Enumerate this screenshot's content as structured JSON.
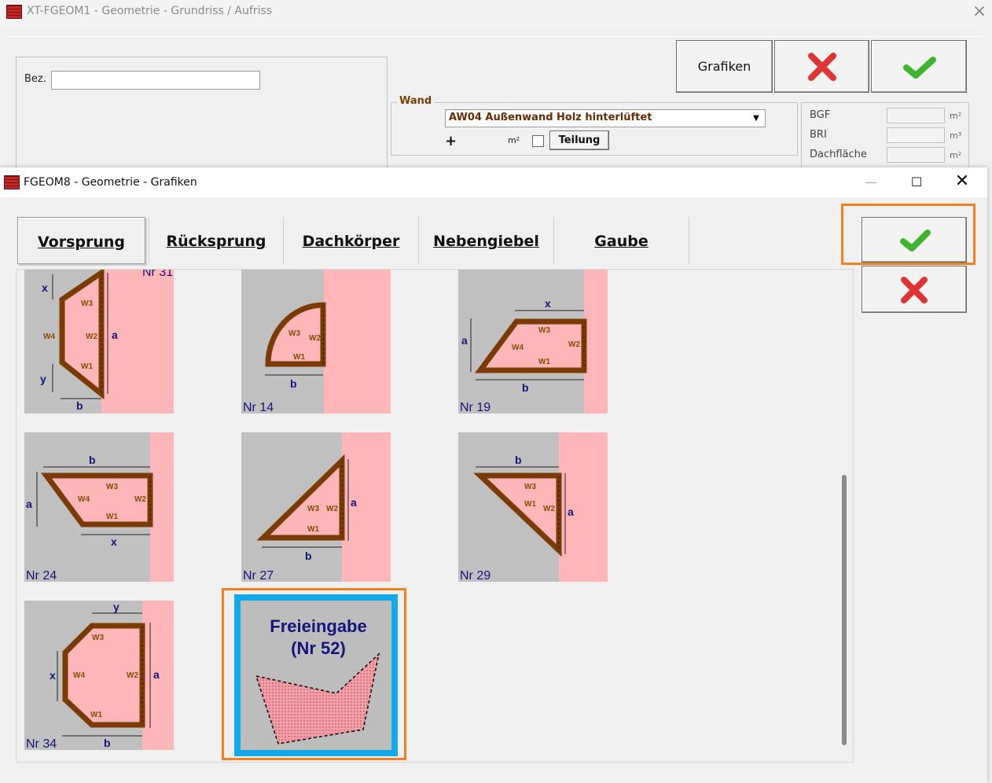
{
  "bg_window": {
    "title": "XT-FGEOM1 - Geometrie - Grundriss / Aufriss",
    "close_glyph": "×",
    "bez_label": "Bez.",
    "bez_value": "",
    "grafiken_label": "Grafiken",
    "cancel_icon": "red-x-icon",
    "ok_icon": "green-check-icon",
    "wand": {
      "group_label": "Wand",
      "selected": "AW04 Außenwand Holz hinterlüftet",
      "plus": "+",
      "unit": "m²",
      "teilung_label": "Teilung"
    },
    "stats": [
      {
        "label": "BGF",
        "value": "",
        "unit": "m²"
      },
      {
        "label": "BRI",
        "value": "",
        "unit": "m³"
      },
      {
        "label": "Dachfläche",
        "value": "",
        "unit": "m²"
      }
    ]
  },
  "dialog": {
    "title": "FGEOM8 - Geometrie - Grafiken",
    "minimize_glyph": "—",
    "maximize_glyph": "☐",
    "close_glyph": "✕",
    "tabs": [
      {
        "label": "Vorsprung",
        "active": true
      },
      {
        "label": "Rücksprung",
        "active": false
      },
      {
        "label": "Dachkörper",
        "active": false
      },
      {
        "label": "Nebengiebel",
        "active": false
      },
      {
        "label": "Gaube",
        "active": false
      }
    ],
    "ok_icon": "green-check-icon",
    "cancel_icon": "red-x-icon",
    "tiles": [
      {
        "nr": "Nr 31",
        "labels": [
          "x",
          "a",
          "y",
          "b"
        ],
        "walls": [
          "W1",
          "W2",
          "W3",
          "W4"
        ]
      },
      {
        "nr": "Nr 14",
        "labels": [
          "b"
        ],
        "walls": [
          "W1",
          "W2",
          "W3"
        ]
      },
      {
        "nr": "Nr 19",
        "labels": [
          "x",
          "a",
          "b"
        ],
        "walls": [
          "W1",
          "W2",
          "W3",
          "W4"
        ]
      },
      {
        "nr": "Nr 24",
        "labels": [
          "b",
          "a",
          "x"
        ],
        "walls": [
          "W1",
          "W2",
          "W3",
          "W4"
        ]
      },
      {
        "nr": "Nr 27",
        "labels": [
          "a",
          "b"
        ],
        "walls": [
          "W1",
          "W2",
          "W3"
        ]
      },
      {
        "nr": "Nr 29",
        "labels": [
          "b",
          "a"
        ],
        "walls": [
          "W1",
          "W2",
          "W3"
        ]
      },
      {
        "nr": "Nr 34",
        "labels": [
          "y",
          "x",
          "a",
          "b"
        ],
        "walls": [
          "W1",
          "W2",
          "W3",
          "W4"
        ]
      }
    ],
    "free_entry": {
      "line1": "Freieingabe",
      "line2": "(Nr 52)"
    },
    "colors": {
      "wall_brown": "#7a3b05",
      "building_pink": "#ffb6b9",
      "tile_gray": "#c0c0c0",
      "label_navy": "#15157a",
      "highlight_orange": "#f2801f",
      "selection_blue": "#13a8e8"
    }
  }
}
